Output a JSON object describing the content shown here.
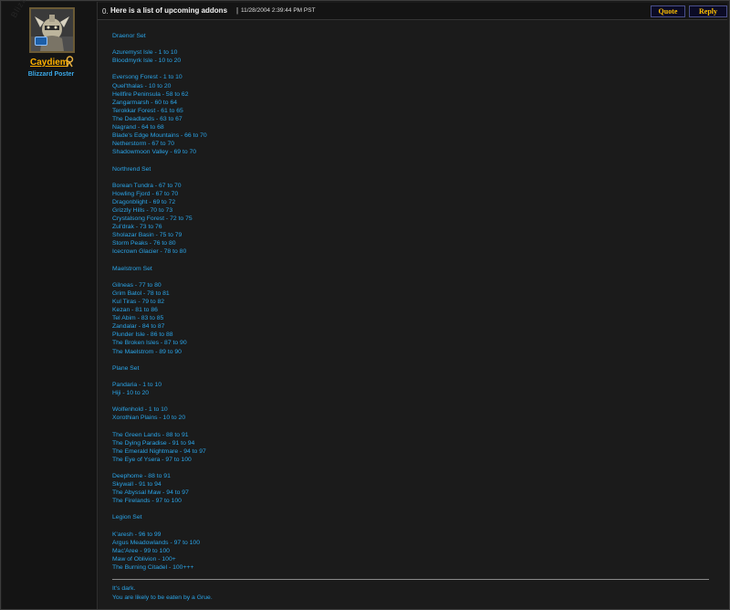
{
  "user": {
    "name": "Caydiem",
    "rank": "Blizzard Poster",
    "watermark": "Blizzard"
  },
  "post": {
    "number": "0.",
    "title": "Here is a list of upcoming addons",
    "separator": "|",
    "date": "11/28/2004 2:39:44 PM PST",
    "quote_label": "Quote",
    "reply_label": "Reply"
  },
  "body": [
    "Draenor Set",
    "",
    "Azuremyst Isle - 1 to 10",
    "Bloodmyrk Isle - 10 to 20",
    "",
    "Eversong Forest - 1 to 10",
    "Quel'thalas - 10 to 20",
    "Hellfire Peninsula - 58 to 62",
    "Zangarmarsh - 60 to 64",
    "Terokkar Forest - 61 to 65",
    "The Deadlands - 63 to 67",
    "Nagrand - 64 to 68",
    "Blade's Edge Mountains - 66 to 70",
    "Netherstorm - 67 to 70",
    "Shadowmoon Valley - 69 to 70",
    "",
    "Northrend Set",
    "",
    "Borean Tundra - 67 to 70",
    "Howling Fjord - 67 to 70",
    "Dragonblight - 69 to 72",
    "Grizzly Hills - 70 to 73",
    "Crystalsong Forest - 72 to 75",
    "Zul'drak - 73 to 76",
    "Sholazar Basin - 75 to 79",
    "Storm Peaks - 76 to 80",
    "Icecrown Glacier - 78 to 80",
    "",
    "Maelstrom Set",
    "",
    "Gilneas - 77 to 80",
    "Grim Batol - 78 to 81",
    "Kul Tiras - 79 to 82",
    "Kezan - 81 to 86",
    "Tel Abim - 83 to 85",
    "Zandalar - 84 to 87",
    "Plunder Isle - 86 to 88",
    "The Broken Isles - 87 to 90",
    "The Maelstrom - 89 to 90",
    "",
    "Plane Set",
    "",
    "Pandaria - 1 to 10",
    "Hiji - 10 to 20",
    "",
    "Wolfenhold - 1 to 10",
    "Xorothian Plains - 10 to 20",
    "",
    "The Green Lands - 88 to 91",
    "The Dying Paradise - 91 to 94",
    "The Emerald Nightmare - 94 to 97",
    "The Eye of Ysera - 97 to 100",
    "",
    "Deephome - 88 to 91",
    "Skywall - 91 to 94",
    "The Abyssal Maw - 94 to 97",
    "The Firelands - 97 to 100",
    "",
    "Legion Set",
    "",
    "K'aresh - 96 to 99",
    "Argus Meadowlands - 97 to 100",
    "Mac'Aree - 99 to 100",
    "Maw of Oblivion - 100+",
    "The Burning Citadel - 100+++"
  ],
  "signature": {
    "line1": "It's dark.",
    "line2": "You are likely to be eaten by a Grue."
  },
  "colors": {
    "body_text": "#2aa4e8",
    "username": "#ffb100",
    "button_text": "#ffbf00",
    "background": "#1b1b1b"
  },
  "icons": {
    "avatar": "armored-warrior-avatar",
    "user_icon": "blizzard-rep-icon"
  }
}
